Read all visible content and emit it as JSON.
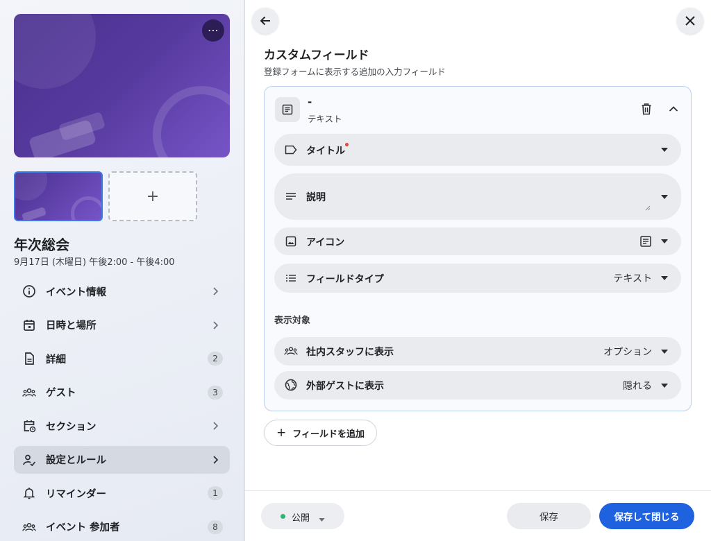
{
  "sidebar": {
    "more_label": "⋯",
    "add_image_label": "+",
    "event_title": "年次総会",
    "event_date": "9月17日 (木曜日) 午後2:00 - 午後4:00",
    "nav": [
      {
        "label": "イベント情報",
        "icon": "info-icon",
        "right": "chevron"
      },
      {
        "label": "日時と場所",
        "icon": "calendar-icon",
        "right": "chevron"
      },
      {
        "label": "詳細",
        "icon": "document-icon",
        "right": "badge",
        "badge": "2"
      },
      {
        "label": "ゲスト",
        "icon": "guests-icon",
        "right": "badge",
        "badge": "3"
      },
      {
        "label": "セクション",
        "icon": "calendar-clock-icon",
        "right": "chevron"
      },
      {
        "label": "設定とルール",
        "icon": "person-check-icon",
        "right": "chevron",
        "active": true
      },
      {
        "label": "リマインダー",
        "icon": "bell-icon",
        "right": "badge",
        "badge": "1"
      },
      {
        "label": "イベント 参加者",
        "icon": "attendees-icon",
        "right": "badge",
        "badge": "8"
      }
    ]
  },
  "main": {
    "title": "カスタムフィールド",
    "subtitle": "登録フォームに表示する追加の入力フィールド",
    "field": {
      "name": "-",
      "type": "テキスト",
      "rows": {
        "title_label": "タイトル",
        "description_label": "説明",
        "icon_label": "アイコン",
        "field_type_label": "フィールドタイプ",
        "field_type_value": "テキスト"
      },
      "visibility_heading": "表示対象",
      "staff_label": "社内スタッフに表示",
      "staff_value": "オプション",
      "guest_label": "外部ゲストに表示",
      "guest_value": "隠れる"
    },
    "add_field_label": "フィールドを追加",
    "add_field_plus": "+"
  },
  "footer": {
    "status_label": "公開",
    "status_color": "#2bb673",
    "save_label": "保存",
    "save_close_label": "保存して閉じる",
    "primary_color": "#1f62e0"
  }
}
